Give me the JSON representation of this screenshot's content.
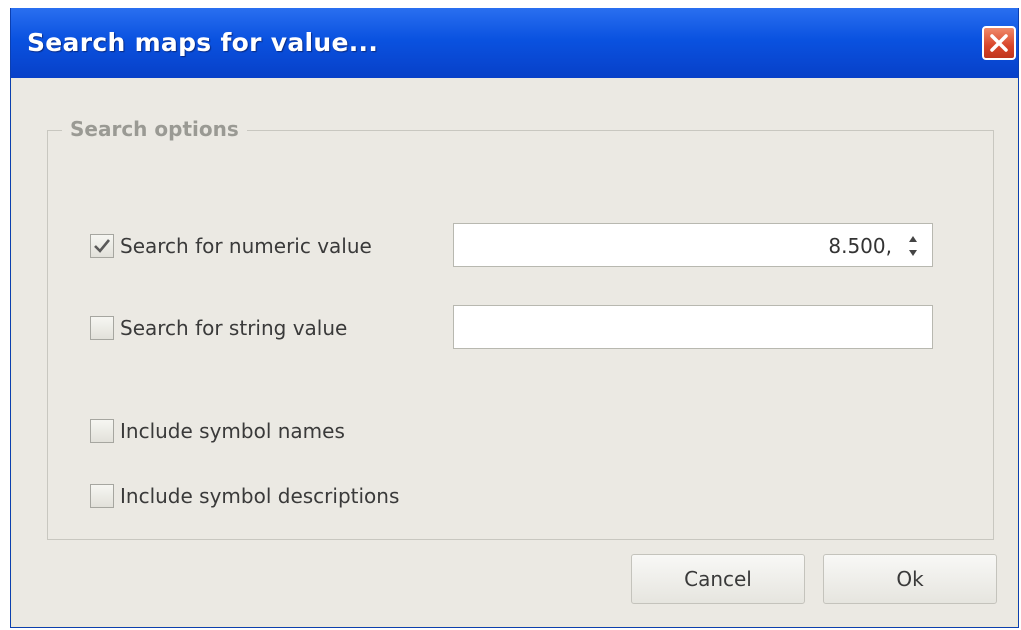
{
  "window": {
    "title": "Search maps for value...",
    "close_icon": "close-icon"
  },
  "search_options": {
    "legend": "Search options",
    "numeric": {
      "label": "Search for numeric value",
      "checked": true,
      "value": "8.500,"
    },
    "string": {
      "label": "Search for string value",
      "checked": false,
      "value": ""
    },
    "include_names": {
      "label": "Include symbol names",
      "checked": false
    },
    "include_descriptions": {
      "label": "Include symbol descriptions",
      "checked": false
    }
  },
  "buttons": {
    "cancel_label": "Cancel",
    "ok_label": "Ok"
  }
}
